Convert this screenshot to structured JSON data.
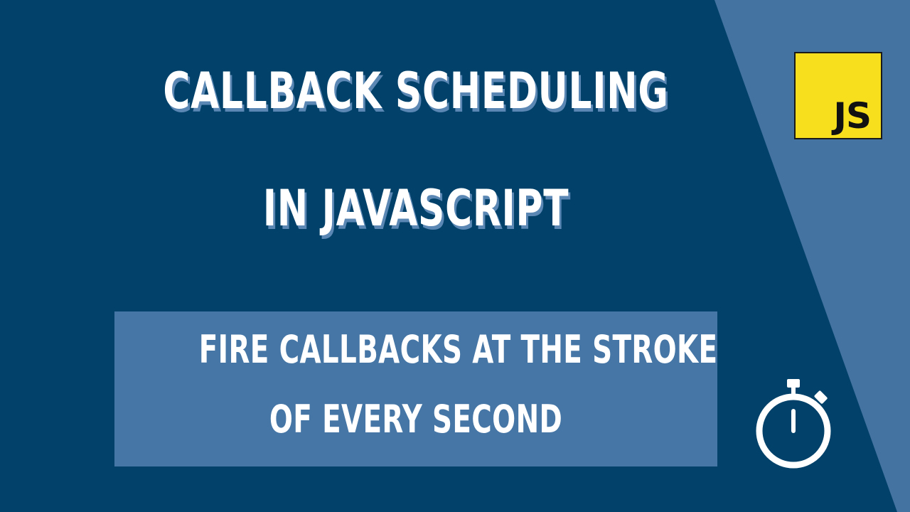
{
  "colors": {
    "background": "#02426a",
    "diagonal_panel": "#4472a1",
    "subtitle_box": "#4676a5",
    "title_shadow": "#5a87b3",
    "js_logo_yellow": "#f7df1e",
    "text": "#ffffff"
  },
  "title": {
    "line1": "CALLBACK SCHEDULING",
    "line2": "IN JAVASCRIPT"
  },
  "subtitle": {
    "line1": "FIRE CALLBACKS AT THE STROKE",
    "line2": "OF EVERY SECOND"
  },
  "logo": {
    "text": "JS",
    "icon": "javascript-logo-icon"
  },
  "stopwatch": {
    "icon": "stopwatch-icon"
  }
}
